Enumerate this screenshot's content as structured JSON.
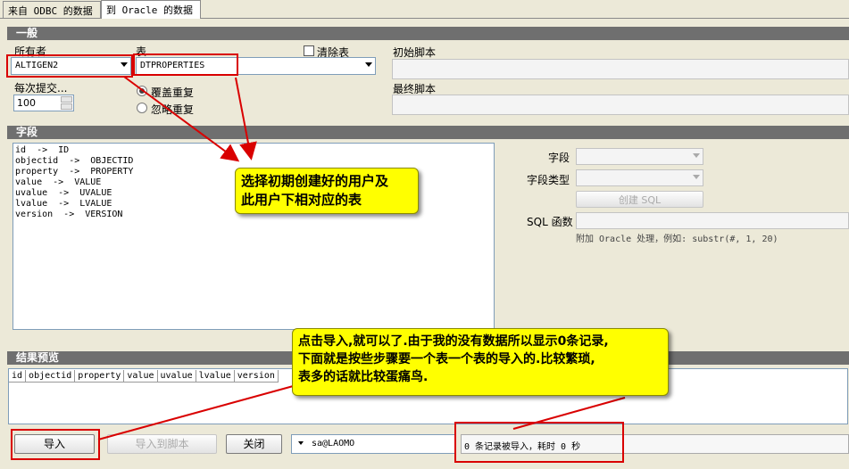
{
  "tabs": [
    {
      "label": "来自 ODBC 的数据",
      "active": false
    },
    {
      "label": "到 Oracle 的数据",
      "active": true
    }
  ],
  "general": {
    "section_title": "一般",
    "owner_label": "所有者",
    "owner_value": "ALTIGEN2",
    "table_label": "表",
    "table_value": "DTPROPERTIES",
    "clear_table_label": "清除表",
    "clear_table_checked": false,
    "commit_label": "每次提交...",
    "commit_value": "100",
    "overwrite_label": "覆盖重复",
    "ignore_label": "忽略重复",
    "selected_duplicate_mode": "overwrite",
    "init_script_label": "初始脚本",
    "final_script_label": "最终脚本"
  },
  "fields": {
    "section_title": "字段",
    "mappings": [
      "id  ->  ID",
      "objectid  ->  OBJECTID",
      "property  ->  PROPERTY",
      "value  ->  VALUE",
      "uvalue  ->  UVALUE",
      "lvalue  ->  LVALUE",
      "version  ->  VERSION"
    ],
    "field_label": "字段",
    "field_type_label": "字段类型",
    "create_sql_button": "创建 SQL",
    "sql_function_label": "SQL 函数",
    "hint": "附加 Oracle 处理，例如:  substr(#, 1, 20)"
  },
  "preview": {
    "section_title": "结果预览",
    "columns": [
      "id",
      "objectid",
      "property",
      "value",
      "uvalue",
      "lvalue",
      "version"
    ]
  },
  "footer": {
    "import_button": "导入",
    "import_to_script_button": "导入到脚本",
    "close_button": "关闭",
    "connection": "sa@LAOMO",
    "status": "0 条记录被导入，耗时 0 秒"
  },
  "annotations": {
    "callout1": [
      "选择初期创建好的用户及",
      "此用户下相对应的表"
    ],
    "callout2": [
      "点击导入,就可以了.由于我的没有数据所以显示0条记录,",
      "下面就是按些步骤要一个表一个表的导入的.比较繁琐,",
      "表多的话就比较蛋痛鸟."
    ],
    "highlight_color": "#ffff00",
    "annotation_color": "#d90000"
  }
}
